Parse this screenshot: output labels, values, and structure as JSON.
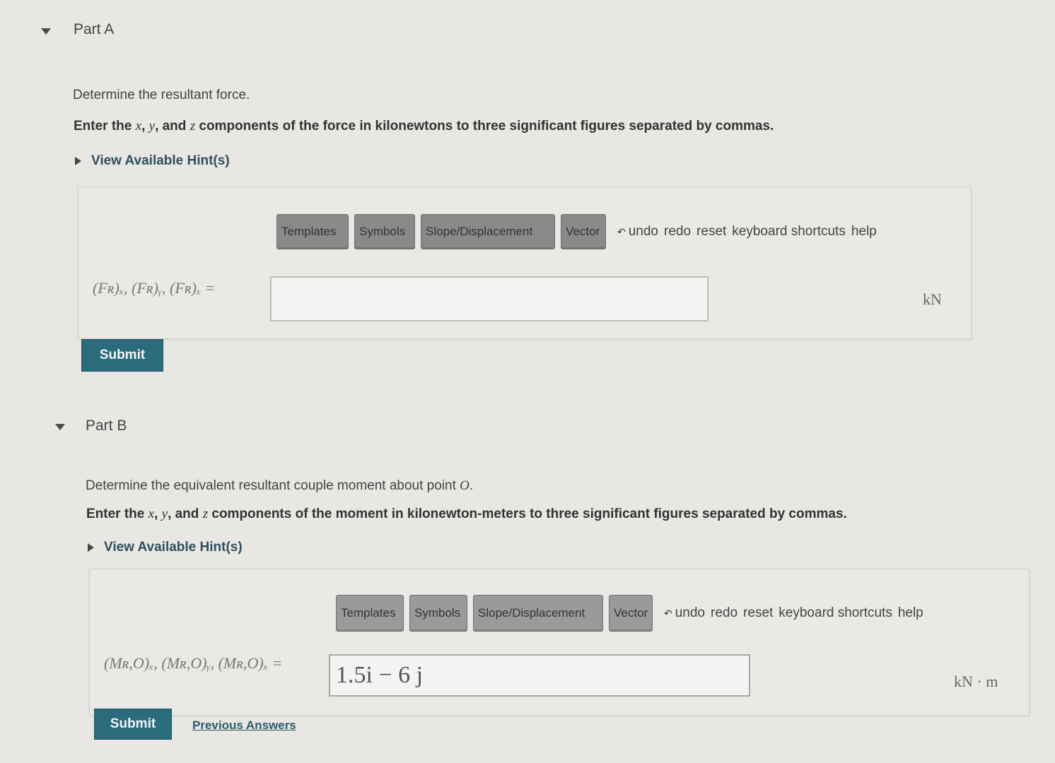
{
  "partA": {
    "title": "Part A",
    "prompt": "Determine the resultant force.",
    "instructions_pre": "Enter the ",
    "var_x": "x",
    "sep1": ", ",
    "var_y": "y",
    "sep2": ", and ",
    "var_z": "z",
    "instructions_post": " components of the force in kilonewtons to three significant figures separated by commas.",
    "hint_label": "View Available Hint(s)",
    "answer_label": "(Fʀ)ₓ, (Fʀ)ᵧ, (Fʀ)ₓ =",
    "answer_value": "",
    "unit": "kN",
    "submit_label": "Submit"
  },
  "partB": {
    "title": "Part B",
    "prompt_pre": "Determine the equivalent resultant couple moment about point ",
    "point": "O",
    "prompt_post": ".",
    "instructions_pre": "Enter the ",
    "var_x": "x",
    "sep1": ", ",
    "var_y": "y",
    "sep2": ", and ",
    "var_z": "z",
    "instructions_post": " components of the moment in kilonewton-meters to three significant figures separated by commas.",
    "hint_label": "View Available Hint(s)",
    "answer_label": "(Mʀ,O)ₓ, (Mʀ,O)ᵧ, (Mʀ,O)ₓ =",
    "answer_value": "1.5i − 6 j",
    "unit": "kN · m",
    "submit_label": "Submit",
    "previous_answers_label": "Previous Answers"
  },
  "toolbar": {
    "templates": "Templates",
    "symbols": "Symbols",
    "slope": "Slope/Displacement",
    "vector": "Vector",
    "undo": "undo",
    "redo": "redo",
    "reset": "reset",
    "keyboard": "keyboard shortcuts",
    "help": "help"
  }
}
